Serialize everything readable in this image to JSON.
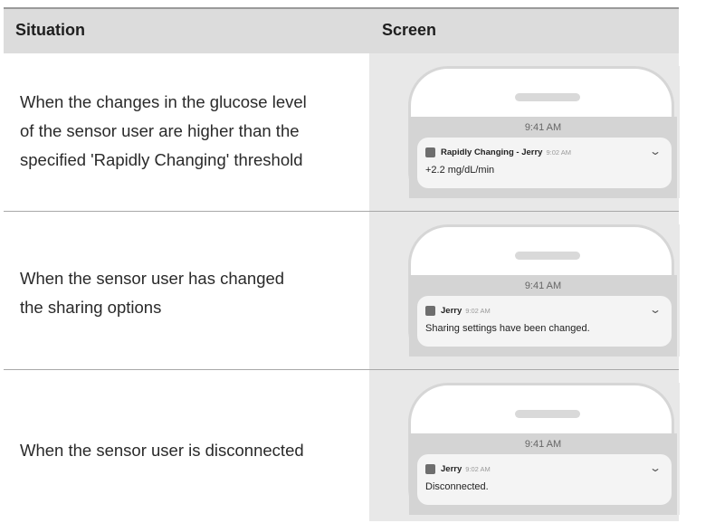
{
  "table": {
    "headers": {
      "situation": "Situation",
      "screen": "Screen"
    },
    "rows": [
      {
        "situation": "When the changes in the glucose level of the sensor user are higher than the specified 'Rapidly Changing' threshold",
        "lines": [
          "When the changes in the glucose level",
          "of the sensor user are higher than the",
          "specified 'Rapidly Changing' threshold"
        ],
        "phone": {
          "time": "9:41 AM",
          "title": "Rapidly Changing - Jerry",
          "stamp": "9:02 AM",
          "body": "+2.2 mg/dL/min"
        }
      },
      {
        "situation": "When the sensor user has changed the sharing options",
        "lines": [
          "When the sensor user has changed",
          "the sharing options"
        ],
        "phone": {
          "time": "9:41 AM",
          "title": "Jerry",
          "stamp": "9:02 AM",
          "body": "Sharing settings have been changed."
        }
      },
      {
        "situation": "When the sensor user is disconnected",
        "lines": [
          "When the sensor user is disconnected"
        ],
        "phone": {
          "time": "9:41 AM",
          "title": "Jerry",
          "stamp": "9:02 AM",
          "body": "Disconnected."
        }
      }
    ]
  },
  "icons": {
    "app": "app-icon",
    "expand": "chevron-down-icon"
  },
  "colors": {
    "header_bg": "#dcdcdc",
    "screen_column_bg": "#e8e8e8"
  }
}
